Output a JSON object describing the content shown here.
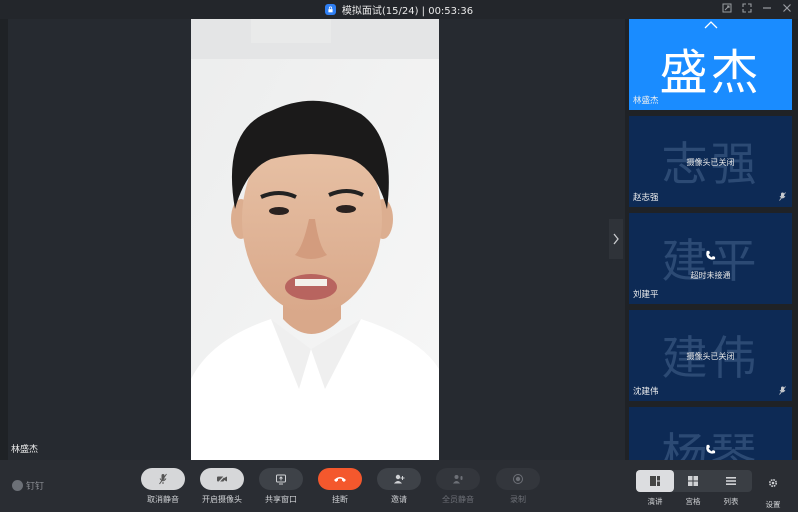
{
  "window": {
    "title": "模拟面试(15/24) | 00:53:36"
  },
  "main": {
    "speaker_name": "林盛杰"
  },
  "participants": [
    {
      "big_label": "盛杰",
      "name": "林盛杰",
      "status": "",
      "active": true
    },
    {
      "big_label": "志强",
      "name": "赵志强",
      "status": "摄像头已关闭",
      "active": false
    },
    {
      "big_label": "建平",
      "name": "刘建平",
      "status": "超时未接通",
      "active": false
    },
    {
      "big_label": "建伟",
      "name": "沈建伟",
      "status": "摄像头已关闭",
      "active": false
    },
    {
      "big_label": "杨琴",
      "name": "",
      "status": "",
      "active": false
    }
  ],
  "toolbar": {
    "app_logo": "钉钉",
    "unmute": "取消静音",
    "camera_on": "开启摄像头",
    "share_window": "共享窗口",
    "hangup": "挂断",
    "invite": "邀请",
    "mute_all": "全员静音",
    "record": "录制",
    "view_speaker": "演讲",
    "view_gallery": "宫格",
    "view_list": "列表",
    "settings": "设置"
  },
  "colors": {
    "accent": "#1a8cff",
    "hangup": "#f4582d",
    "tile_bg": "#0d2a55",
    "bar_bg": "#2a2d33"
  }
}
